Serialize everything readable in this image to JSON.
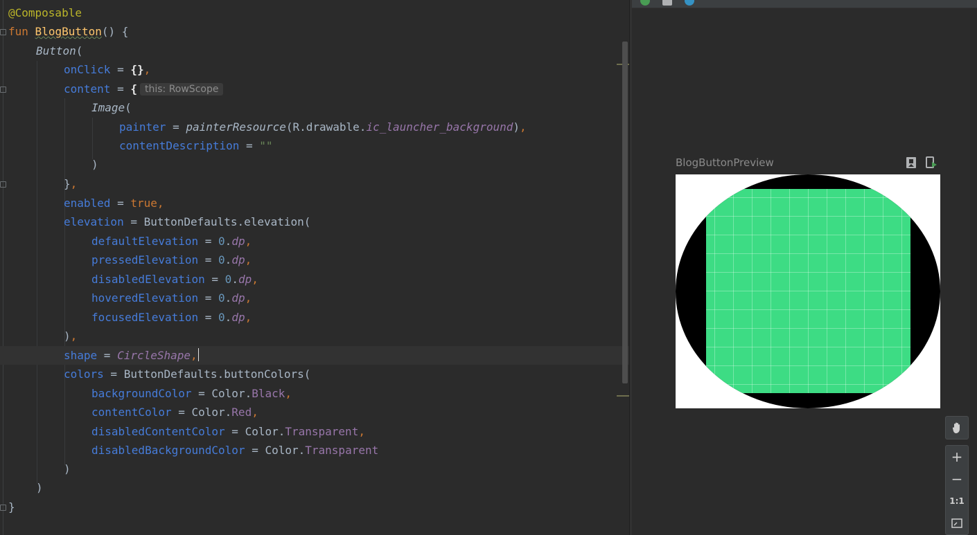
{
  "editor": {
    "annotation": "@Composable",
    "fun_keyword": "fun",
    "function_name": "BlogButton",
    "function_sig_rest": "() {",
    "button_call": "Button",
    "open_paren": "(",
    "onclick_param": "onClick",
    "onclick_eq": " = ",
    "onclick_value": "{}",
    "comma": ",",
    "content_param": "content",
    "content_eq": " = ",
    "content_brace": "{",
    "content_hint": "this: RowScope",
    "image_call": "Image",
    "painter_param": "painter",
    "painter_eq": " = ",
    "painter_fn": "painterResource",
    "painter_arg_prefix": "(R.drawable.",
    "painter_arg_res": "ic_launcher_background",
    "painter_arg_close": ")",
    "desc_param": "contentDescription",
    "desc_eq": " = ",
    "desc_value": "\"\"",
    "close_paren": ")",
    "close_brace": "}",
    "enabled_param": "enabled",
    "enabled_eq": " = ",
    "enabled_value": "true",
    "elevation_param": "elevation",
    "elevation_eq": " = ",
    "elevation_call": "ButtonDefaults.elevation(",
    "elevations": [
      {
        "name": "defaultElevation",
        "eq": " = ",
        "num": "0",
        "unit": "dp"
      },
      {
        "name": "pressedElevation",
        "eq": " = ",
        "num": "0",
        "unit": "dp"
      },
      {
        "name": "disabledElevation",
        "eq": " = ",
        "num": "0",
        "unit": "dp"
      },
      {
        "name": "hoveredElevation",
        "eq": " = ",
        "num": "0",
        "unit": "dp"
      },
      {
        "name": "focusedElevation",
        "eq": " = ",
        "num": "0",
        "unit": "dp"
      }
    ],
    "dot": ".",
    "shape_param": "shape",
    "shape_eq": " = ",
    "shape_value": "CircleShape",
    "colors_param": "colors",
    "colors_eq": " = ",
    "colors_call": "ButtonDefaults.buttonColors(",
    "color_args": [
      {
        "name": "backgroundColor",
        "eq": " = ",
        "prefix": "Color.",
        "value": "Black",
        "comma": ","
      },
      {
        "name": "contentColor",
        "eq": " = ",
        "prefix": "Color.",
        "value": "Red",
        "comma": ","
      },
      {
        "name": "disabledContentColor",
        "eq": " = ",
        "prefix": "Color.",
        "value": "Transparent",
        "comma": ","
      },
      {
        "name": "disabledBackgroundColor",
        "eq": " = ",
        "prefix": "Color.",
        "value": "Transparent",
        "comma": ""
      }
    ]
  },
  "preview": {
    "title": "BlogButtonPreview",
    "button_fill_color": "#000000",
    "image_color": "#3ddc84",
    "pin_icon": "preview-pin-icon",
    "deploy_icon": "deploy-preview-icon"
  },
  "zoom_controls": {
    "pan_icon": "hand-icon",
    "zoom_in": "+",
    "zoom_out": "−",
    "actual_size": "1:1",
    "fit_icon": "zoom-to-fit-icon"
  }
}
